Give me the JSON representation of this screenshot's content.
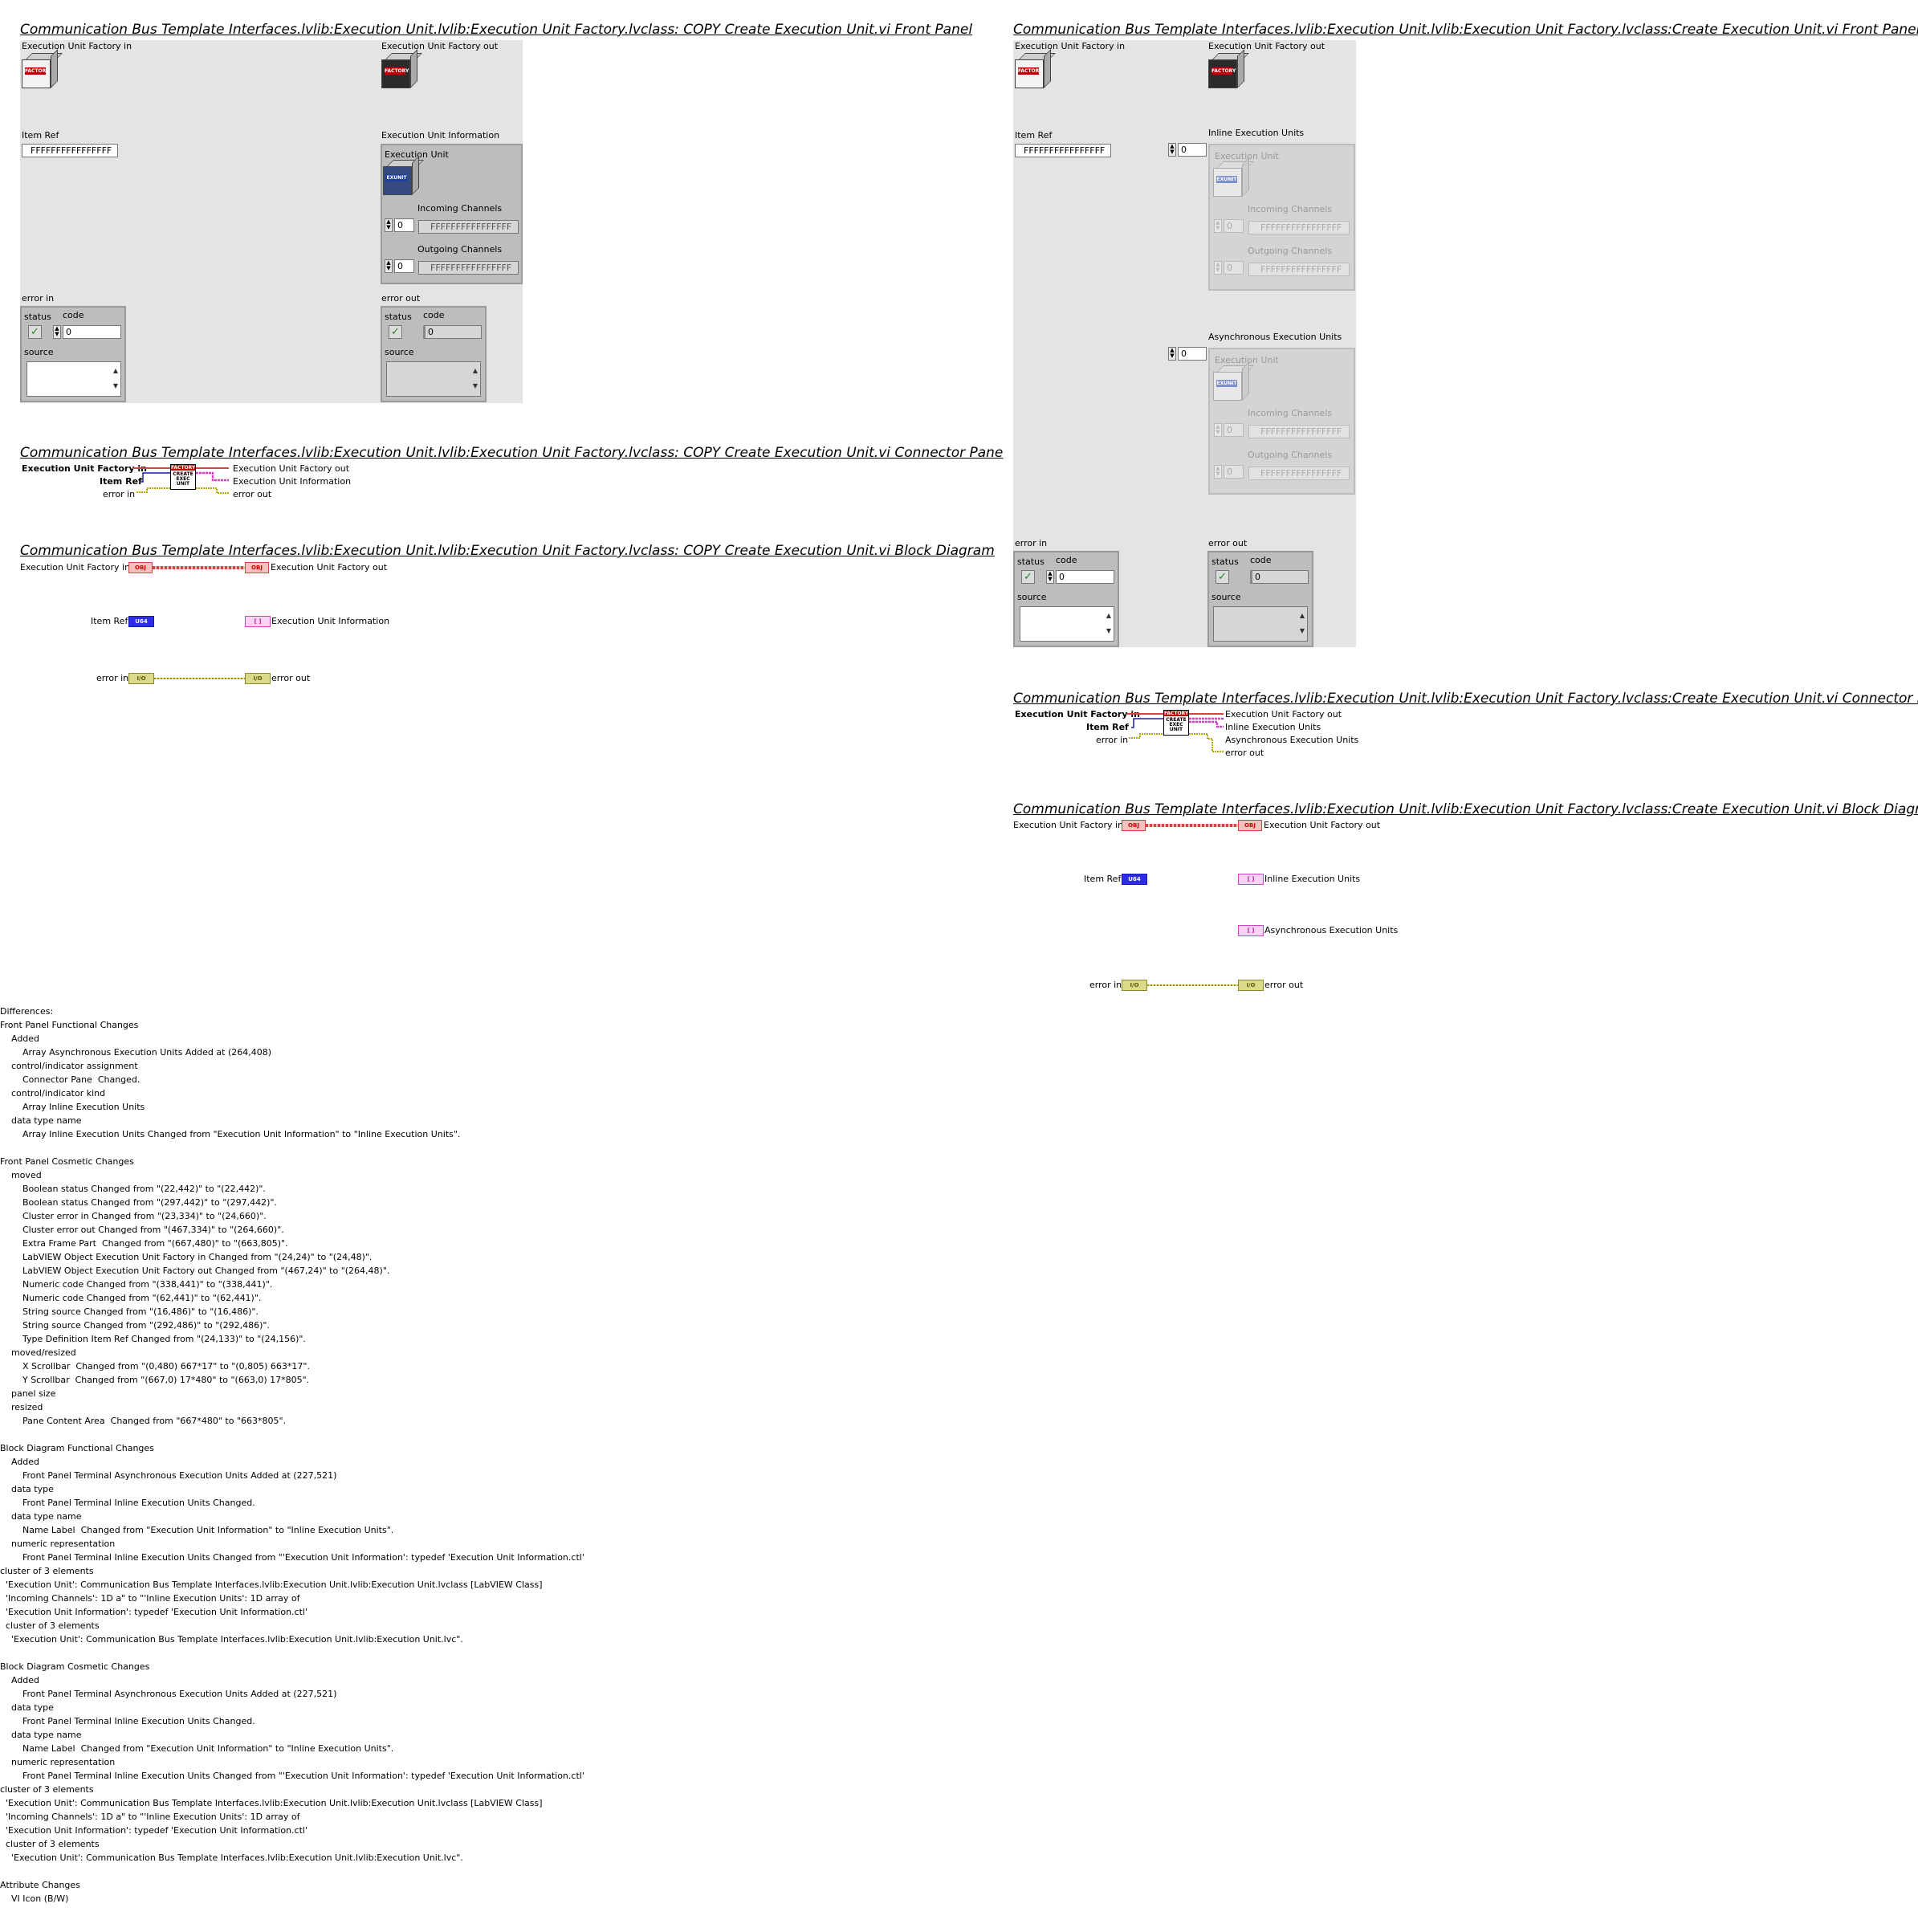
{
  "left": {
    "fp_title": "Communication Bus Template Interfaces.lvlib:Execution Unit.lvlib:Execution Unit Factory.lvclass:  COPY  Create Execution Unit.vi Front Panel",
    "cp_title": "Communication Bus Template Interfaces.lvlib:Execution Unit.lvlib:Execution Unit Factory.lvclass:  COPY  Create Execution Unit.vi Connector Pane",
    "bd_title": "Communication Bus Template Interfaces.lvlib:Execution Unit.lvlib:Execution Unit Factory.lvclass:  COPY  Create Execution Unit.vi Block Diagram",
    "factory_in": "Execution Unit Factory in",
    "factory_out": "Execution Unit Factory out",
    "item_ref": "Item Ref",
    "item_ref_value": "FFFFFFFFFFFFFFFF",
    "exec_unit_info": "Execution Unit Information",
    "exec_unit": "Execution Unit",
    "incoming": "Incoming Channels",
    "outgoing": "Outgoing Channels",
    "index_value": "0",
    "channel_value": "FFFFFFFFFFFFFFFF",
    "error_in": "error in",
    "error_out": "error out",
    "status": "status",
    "code": "code",
    "code_value": "0",
    "source": "source"
  },
  "right": {
    "fp_title": "Communication Bus Template Interfaces.lvlib:Execution Unit.lvlib:Execution Unit Factory.lvclass:Create Execution Unit.vi Front Panel",
    "cp_title": "Communication Bus Template Interfaces.lvlib:Execution Unit.lvlib:Execution Unit Factory.lvclass:Create Execution Unit.vi Connector Pane",
    "bd_title": "Communication Bus Template Interfaces.lvlib:Execution Unit.lvlib:Execution Unit Factory.lvclass:Create Execution Unit.vi Block Diagram",
    "inline": "Inline Execution Units",
    "async": "Asynchronous Execution Units"
  },
  "terminals": {
    "obj": "OBJ",
    "ref": "U64",
    "err": "I/O",
    "arr": "[ ]"
  },
  "icon": {
    "header": "FACTORY",
    "body": "CREATE EXEC UNIT",
    "unit_badge": "EXUNIT"
  },
  "diff_text": "Differences:\nFront Panel Functional Changes\n    Added\n        Array Asynchronous Execution Units Added at (264,408)\n    control/indicator assignment\n        Connector Pane  Changed.\n    control/indicator kind\n        Array Inline Execution Units\n    data type name\n        Array Inline Execution Units Changed from \"Execution Unit Information\" to \"Inline Execution Units\".\n\nFront Panel Cosmetic Changes\n    moved\n        Boolean status Changed from \"(22,442)\" to \"(22,442)\".\n        Boolean status Changed from \"(297,442)\" to \"(297,442)\".\n        Cluster error in Changed from \"(23,334)\" to \"(24,660)\".\n        Cluster error out Changed from \"(467,334)\" to \"(264,660)\".\n        Extra Frame Part  Changed from \"(667,480)\" to \"(663,805)\".\n        LabVIEW Object Execution Unit Factory in Changed from \"(24,24)\" to \"(24,48)\".\n        LabVIEW Object Execution Unit Factory out Changed from \"(467,24)\" to \"(264,48)\".\n        Numeric code Changed from \"(338,441)\" to \"(338,441)\".\n        Numeric code Changed from \"(62,441)\" to \"(62,441)\".\n        String source Changed from \"(16,486)\" to \"(16,486)\".\n        String source Changed from \"(292,486)\" to \"(292,486)\".\n        Type Definition Item Ref Changed from \"(24,133)\" to \"(24,156)\".\n    moved/resized\n        X Scrollbar  Changed from \"(0,480) 667*17\" to \"(0,805) 663*17\".\n        Y Scrollbar  Changed from \"(667,0) 17*480\" to \"(663,0) 17*805\".\n    panel size\n    resized\n        Pane Content Area  Changed from \"667*480\" to \"663*805\".\n\nBlock Diagram Functional Changes\n    Added\n        Front Panel Terminal Asynchronous Execution Units Added at (227,521)\n    data type\n        Front Panel Terminal Inline Execution Units Changed.\n    data type name\n        Name Label  Changed from \"Execution Unit Information\" to \"Inline Execution Units\".\n    numeric representation\n        Front Panel Terminal Inline Execution Units Changed from \"'Execution Unit Information': typedef 'Execution Unit Information.ctl'\ncluster of 3 elements\n  'Execution Unit': Communication Bus Template Interfaces.lvlib:Execution Unit.lvlib:Execution Unit.lvclass [LabVIEW Class]\n  'Incoming Channels': 1D a\" to \"'Inline Execution Units': 1D array of\n  'Execution Unit Information': typedef 'Execution Unit Information.ctl'\n  cluster of 3 elements\n    'Execution Unit': Communication Bus Template Interfaces.lvlib:Execution Unit.lvlib:Execution Unit.lvc\".\n\nBlock Diagram Cosmetic Changes\n    Added\n        Front Panel Terminal Asynchronous Execution Units Added at (227,521)\n    data type\n        Front Panel Terminal Inline Execution Units Changed.\n    data type name\n        Name Label  Changed from \"Execution Unit Information\" to \"Inline Execution Units\".\n    numeric representation\n        Front Panel Terminal Inline Execution Units Changed from \"'Execution Unit Information': typedef 'Execution Unit Information.ctl'\ncluster of 3 elements\n  'Execution Unit': Communication Bus Template Interfaces.lvlib:Execution Unit.lvlib:Execution Unit.lvclass [LabVIEW Class]\n  'Incoming Channels': 1D a\" to \"'Inline Execution Units': 1D array of\n  'Execution Unit Information': typedef 'Execution Unit Information.ctl'\n  cluster of 3 elements\n    'Execution Unit': Communication Bus Template Interfaces.lvlib:Execution Unit.lvlib:Execution Unit.lvc\".\n\nAttribute Changes\n    VI Icon (B/W)"
}
